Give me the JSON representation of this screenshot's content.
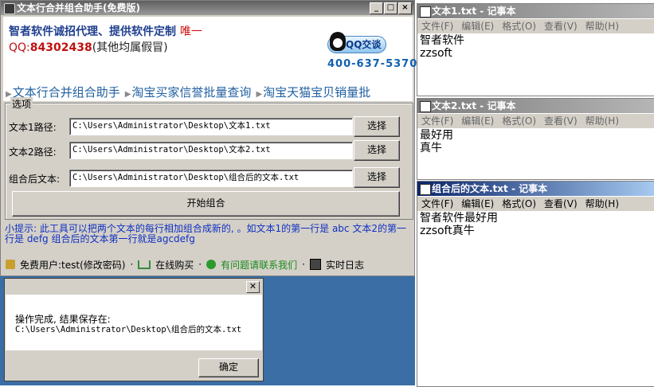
{
  "app": {
    "title": "文本行合并组合助手(免费版)",
    "ad_line1": "智者软件诚招代理、提供软件定制",
    "ad_line1_tail": "唯一",
    "ad_qq_label": "QQ:",
    "ad_qq_number": "84302438",
    "ad_qq_note": "(其他均属假冒)",
    "qq_button": "QQ交谈",
    "phone": "400-637-5370",
    "nav_links": [
      "文本行合并组合助手",
      "淘宝买家信誉批量查询",
      "淘宝天猫宝贝销量批"
    ],
    "options_group_label": "选项",
    "rows": [
      {
        "label": "文本1路径:",
        "value": "C:\\Users\\Administrator\\Desktop\\文本1.txt",
        "button": "选择"
      },
      {
        "label": "文本2路径:",
        "value": "C:\\Users\\Administrator\\Desktop\\文本2.txt",
        "button": "选择"
      },
      {
        "label": "组合后文本:",
        "value": "C:\\Users\\Administrator\\Desktop\\组合后的文本.txt",
        "button": "选择"
      }
    ],
    "start_button": "开始组合",
    "tip_line1": "小提示: 此工具可以把两个文本的每行相加组合成新的, 。如文本1的第一行是 abc 文本2的第一",
    "tip_line2": "行是 defg 组合后的文本第一行就是agcdefg",
    "status": {
      "user": "免费用户:test(修改密码)",
      "buy": "在线购买",
      "contact": "有问题请联系我们",
      "log": "实时日志"
    },
    "colors": {
      "accent_blue": "#1f3f8f",
      "link_blue": "#2060a0",
      "contact_green": "#1a8a1a"
    }
  },
  "dialog": {
    "close": "✕",
    "message": "操作完成, 结果保存在:",
    "path": "C:\\Users\\Administrator\\Desktop\\组合后的文本.txt",
    "ok_button": "确定"
  },
  "notepads": [
    {
      "title": "文本1.txt - 记事本",
      "menu": [
        "文件(F)",
        "编辑(E)",
        "格式(O)",
        "查看(V)",
        "帮助(H)"
      ],
      "content": "智者软件\nzzsoft"
    },
    {
      "title": "文本2.txt - 记事本",
      "menu": [
        "文件(F)",
        "编辑(E)",
        "格式(O)",
        "查看(V)",
        "帮助(H)"
      ],
      "content": "最好用\n真牛"
    },
    {
      "title": "组合后的文本.txt - 记事本",
      "menu": [
        "文件(F)",
        "编辑(E)",
        "格式(O)",
        "查看(V)",
        "帮助(H)"
      ],
      "content": "智者软件最好用\nzzsoft真牛"
    }
  ],
  "icons": [
    "app-icon",
    "minimize-icon",
    "maximize-icon",
    "close-icon",
    "penguin-icon",
    "lock-icon",
    "cart-icon",
    "contact-icon",
    "log-icon",
    "notepad-icon"
  ]
}
